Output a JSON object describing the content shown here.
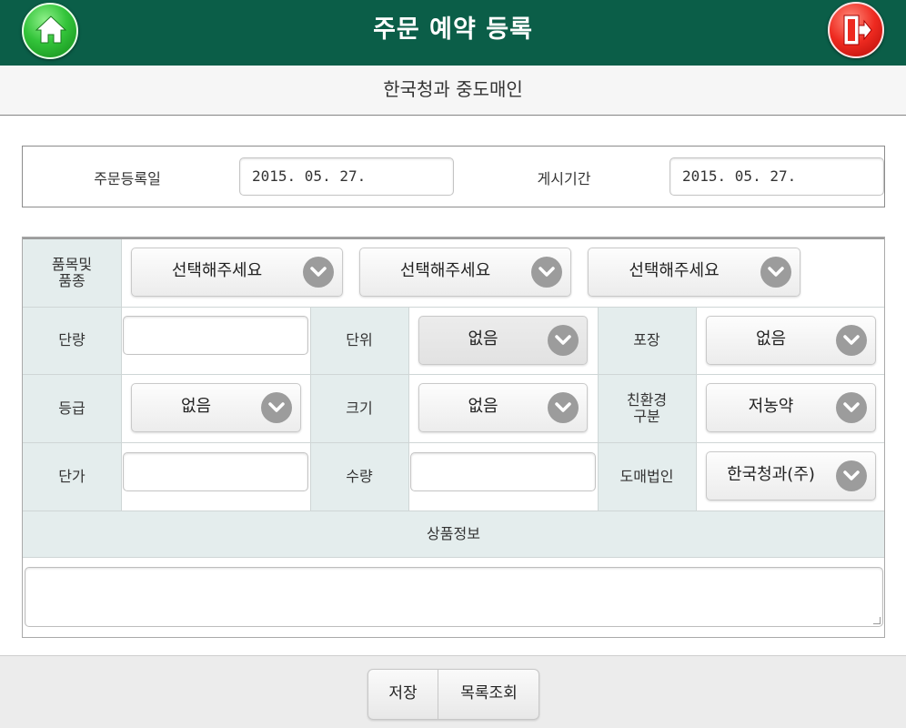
{
  "header": {
    "title": "주문 예약 등록",
    "home_icon": "home-icon",
    "exit_icon": "exit-door-icon",
    "colors": {
      "bar": "#0b5e48",
      "home": "#33c43a",
      "exit": "#ee2a20"
    }
  },
  "subheader": {
    "name": "한국청과 중도매인"
  },
  "dates": {
    "order_date_label": "주문등록일",
    "order_date_value": "2015. 05. 27.",
    "post_period_label": "게시기간",
    "post_period_value": "2015. 05. 27."
  },
  "form": {
    "item_label": "품목및\n품종",
    "item_selects": [
      "선택해주세요",
      "선택해주세요",
      "선택해주세요"
    ],
    "unit_qty_label": "단량",
    "unit_label": "단위",
    "unit_value": "없음",
    "package_label": "포장",
    "package_value": "없음",
    "grade_label": "등급",
    "grade_value": "없음",
    "size_label": "크기",
    "size_value": "없음",
    "eco_label": "친환경\n구분",
    "eco_value": "저농약",
    "price_label": "단가",
    "quantity_label": "수량",
    "wholesaler_label": "도매법인",
    "wholesaler_value": "한국청과(주)",
    "product_info_label": "상품정보"
  },
  "footer": {
    "save_label": "저장",
    "list_label": "목록조회"
  }
}
